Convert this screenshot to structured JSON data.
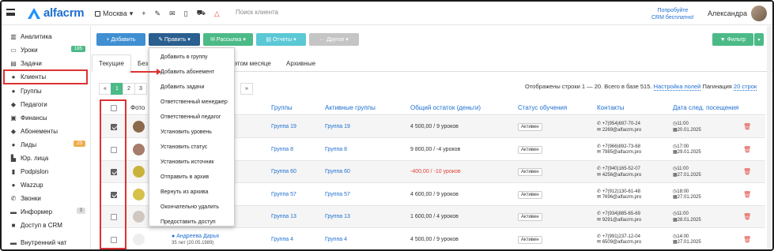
{
  "topbar": {
    "logo": "alfacrm",
    "city": "Москва",
    "search_placeholder": "Поиск клиента",
    "promo_line1": "Попробуйте",
    "promo_line2": "CRM бесплатно!",
    "user": "Александра"
  },
  "sidebar": {
    "items": [
      {
        "label": "Аналитика",
        "icon": "chart-icon"
      },
      {
        "label": "Уроки",
        "icon": "calendar-icon",
        "badge": "185",
        "badge_color": "#4cba87"
      },
      {
        "label": "Задачи",
        "icon": "tasks-icon"
      },
      {
        "label": "Клиенты",
        "icon": "user-icon"
      },
      {
        "label": "Группы",
        "icon": "users-icon"
      },
      {
        "label": "Педагоги",
        "icon": "graduation-icon"
      },
      {
        "label": "Финансы",
        "icon": "money-icon"
      },
      {
        "label": "Абонементы",
        "icon": "tag-icon"
      },
      {
        "label": "Лиды",
        "icon": "lead-icon",
        "badge": "23",
        "badge_color": "#f0ad4e"
      },
      {
        "label": "Юр. лица",
        "icon": "building-icon"
      },
      {
        "label": "Podpislon",
        "icon": "doc-icon"
      },
      {
        "label": "Wazzup",
        "icon": "chat-icon"
      },
      {
        "label": "Звонки",
        "icon": "phone-icon"
      },
      {
        "label": "Информер",
        "icon": "info-icon",
        "badge": "3",
        "badge_color": "#ccc"
      },
      {
        "label": "Доступ в CRM",
        "icon": "lock-icon"
      },
      {
        "label": "Внутренний чат",
        "icon": "message-icon"
      }
    ]
  },
  "toolbar": {
    "add": "+ Добавить",
    "edit": "✎ Править ▾",
    "mailing": "✉ Рассылка ▾",
    "reports": "▤ Отчеты ▾",
    "other": "··· Другое ▾",
    "filter": "▼ Фильтр",
    "filter_caret": "▾"
  },
  "tabs": [
    "Текущие",
    "Без",
    "этом месяце",
    "Архивные"
  ],
  "dropdown": [
    "Добавить в группу",
    "Добавить абонемент",
    "Добавить задачи",
    "Ответственный менеджер",
    "Ответственный педагог",
    "Установить уровень",
    "Установить статус",
    "Установить источник",
    "Отправить в архив",
    "Вернуть из архива",
    "Окончательно удалить",
    "Предоставить доступ"
  ],
  "pagination": {
    "prev": "«",
    "pages": [
      "1",
      "2",
      "3"
    ],
    "next": "»",
    "info_prefix": "Отображены строки 1 — 20. Всего в базе 515.",
    "settings": "Настройка полей",
    "per_page_label": "Пагинация",
    "per_page": "20 строк"
  },
  "table": {
    "headers": {
      "photo": "Фото",
      "groups": "Группы",
      "active_groups": "Активные группы",
      "balance": "Общий остаток (деньги)",
      "status": "Статус обучения",
      "contacts": "Контакты",
      "next_date": "Дата след. посещения"
    },
    "rows": [
      {
        "checked": true,
        "groups": "Группа 19",
        "active": "Группа 19",
        "balance": "4 500,00 / 9 уроков",
        "negative": false,
        "status": "Активен",
        "phone": "+7(954)697-70-24",
        "email": "2269@alfacrm.pro",
        "time": "11:00",
        "date": "20.01.2025",
        "photo": "#8a6a4a"
      },
      {
        "checked": false,
        "groups": "Группа 8",
        "active": "Группа 8",
        "balance": "9 800,00 / -4 уроков",
        "negative": false,
        "status": "Активен",
        "phone": "+7(966)892-73-68",
        "email": "7985@alfacrm.pro",
        "time": "17:00",
        "date": "29.01.2025",
        "photo": "#a67c6a"
      },
      {
        "checked": true,
        "groups": "Группа 60",
        "active": "Группа 60",
        "balance": "-400,00 / -10 уроков",
        "negative": true,
        "status": "Активен",
        "phone": "+7(940)165-52-07",
        "email": "4256@alfacrm.pro",
        "time": "11:00",
        "date": "27.01.2025",
        "photo": "#c9b23a"
      },
      {
        "checked": true,
        "groups": "Группа 57",
        "active": "Группа 57",
        "balance": "4 600,00 / 9 уроков",
        "negative": false,
        "status": "Активен",
        "phone": "+7(912)130-61-48",
        "email": "7696@alfacrm.pro",
        "time": "18:00",
        "date": "27.01.2025",
        "photo": "#d6c14a"
      },
      {
        "checked": false,
        "groups": "Группа 13",
        "active": "Группа 13",
        "balance": "1 600,00 / 4 уроков",
        "negative": false,
        "status": "Активен",
        "phone": "+7(934)885-65-69",
        "email": "9291@alfacrm.pro",
        "time": "11:00",
        "date": "28.01.2025",
        "photo": "#cfc7c0"
      },
      {
        "checked": false,
        "name": "Андреева Дарья",
        "age": "35 лет (20.05.1989)",
        "groups": "Группа 4",
        "active": "Группа 4",
        "balance": "4 500,00 / 9 уроков",
        "negative": false,
        "status": "Активен",
        "phone": "+7(991)237-12-04",
        "email": "6509@alfacrm.pro",
        "time": "14:00",
        "date": "27.01.2025",
        "photo": "#eeeeee"
      }
    ]
  }
}
